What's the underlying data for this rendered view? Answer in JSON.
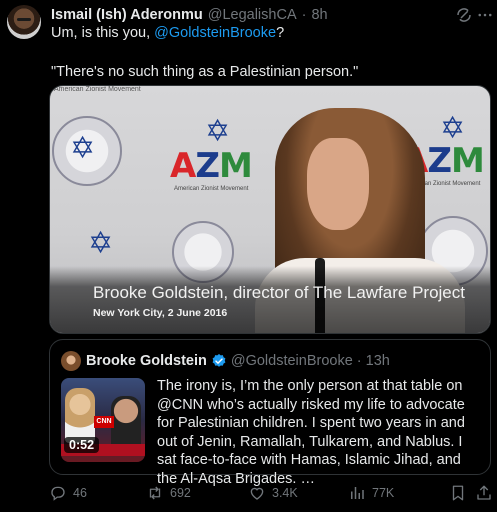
{
  "tweet": {
    "author_name": "Ismail (Ish) Aderonmu",
    "author_handle": "@LegalishCA",
    "separator": "·",
    "time": "8h",
    "text_prefix": "Um, is this you, ",
    "text_mention": "@GoldsteinBrooke",
    "text_suffix": "?",
    "text_quote": "\"There's no such thing as a Palestinian person.\"",
    "icons": {
      "grok": "grok-icon",
      "more": "more-icon"
    }
  },
  "media": {
    "caption_title": "Brooke Goldstein, director of The Lawfare Project",
    "caption_subtitle": "New York City, 2 June 2016",
    "logo_letters": [
      "A",
      "Z",
      "M"
    ],
    "logo_sub": "American Zionist Movement",
    "small_top": "American Zionist Movement"
  },
  "quote": {
    "author_name": "Brooke Goldstein",
    "author_handle": "@GoldsteinBrooke",
    "separator": "·",
    "time": "13h",
    "video_duration": "0:52",
    "thumb_logo": "CNN",
    "text": "The irony is, I’m the only person at that table on @CNN who’s actually risked my life to advocate for Palestinian children. I spent two years in and out of Jenin, Ramallah, Tulkarem, and Nablus. I sat face-to-face with Hamas, Islamic Jihad, and the Al-Aqsa Brigades. …"
  },
  "actions": {
    "replies": "46",
    "reposts": "692",
    "likes": "3.4K",
    "views": "77K"
  },
  "colors": {
    "accent": "#1d9bf0",
    "muted": "#71767b",
    "background": "#000000"
  }
}
